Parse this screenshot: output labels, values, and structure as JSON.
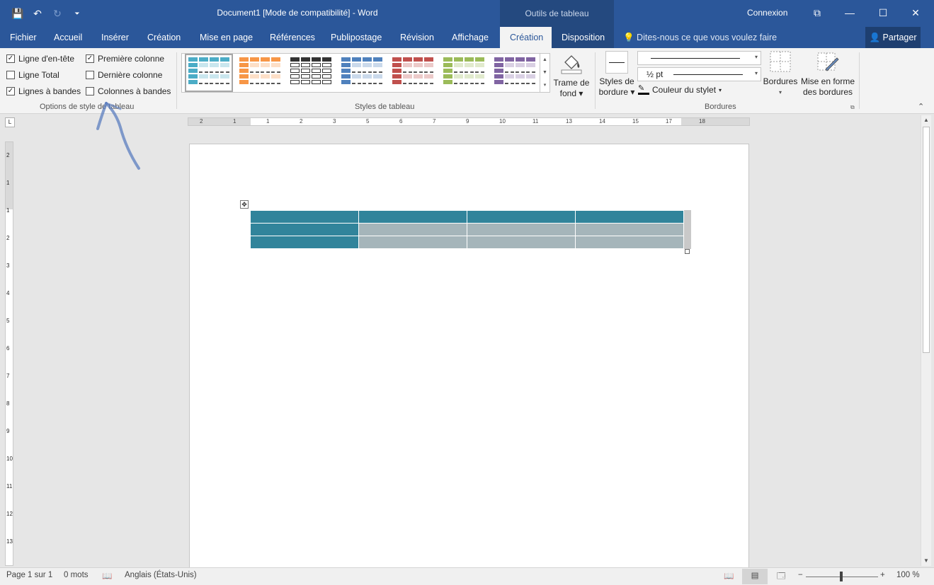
{
  "window": {
    "title": "Document1 [Mode de compatibilité]  -  Word",
    "contextual_tools_label": "Outils de tableau",
    "signin": "Connexion",
    "controls": {
      "restore_ribbon": "⧉",
      "minimize": "—",
      "maximize": "☐",
      "close": "✕"
    }
  },
  "quick_access": {
    "save_icon": "💾",
    "undo_icon": "↶",
    "redo_icon": "↻",
    "customize_icon": "⏷"
  },
  "tabs": {
    "file": "Fichier",
    "home": "Accueil",
    "insert": "Insérer",
    "design": "Création",
    "layout": "Mise en page",
    "references": "Références",
    "mailings": "Publipostage",
    "review": "Révision",
    "view": "Affichage",
    "table_design": "Création",
    "table_layout": "Disposition",
    "tell_me": "Dites-nous ce que vous voulez faire",
    "share": "Partager"
  },
  "style_options": {
    "group_label": "Options de style de tableau",
    "items": [
      {
        "label": "Ligne d'en-tête",
        "checked": true
      },
      {
        "label": "Ligne Total",
        "checked": false
      },
      {
        "label": "Lignes à bandes",
        "checked": true
      },
      {
        "label": "Première colonne",
        "checked": true
      },
      {
        "label": "Dernière colonne",
        "checked": false
      },
      {
        "label": "Colonnes à bandes",
        "checked": false
      }
    ]
  },
  "table_styles": {
    "group_label": "Styles de tableau",
    "thumb_colors": [
      "#4bacc6",
      "#f79646",
      "#404040",
      "#4f81bd",
      "#c0504d",
      "#9bbb59",
      "#8064a2"
    ],
    "shading_label": "Trame de fond",
    "shading_label_line1": "Trame de",
    "shading_label_line2": "fond"
  },
  "borders": {
    "group_label": "Bordures",
    "border_styles_line1": "Styles de",
    "border_styles_line2": "bordure",
    "weight": "½ pt",
    "pen_color": "Couleur du stylet",
    "borders_button": "Bordures",
    "painter_line1": "Mise en forme",
    "painter_line2": "des bordures"
  },
  "ruler": {
    "horizontal_ticks": [
      "2",
      "1",
      "1",
      "2",
      "3",
      "5",
      "6",
      "7",
      "9",
      "10",
      "11",
      "13",
      "14",
      "15",
      "17",
      "18"
    ],
    "vertical_ticks": [
      "2",
      "1",
      "1",
      "2",
      "3",
      "4",
      "5",
      "6",
      "7",
      "8",
      "9",
      "10",
      "11",
      "12",
      "13"
    ]
  },
  "document_table": {
    "rows": [
      [
        "header",
        "header",
        "header",
        "header"
      ],
      [
        "first",
        "band",
        "band",
        "band"
      ],
      [
        "first",
        "band",
        "band",
        "band"
      ]
    ],
    "colors": {
      "header": "#31849b",
      "first": "#31849b",
      "band": "#a5b5ba"
    }
  },
  "status": {
    "page": "Page 1 sur 1",
    "words": "0 mots",
    "language": "Anglais (États-Unis)",
    "zoom": "100 %"
  }
}
